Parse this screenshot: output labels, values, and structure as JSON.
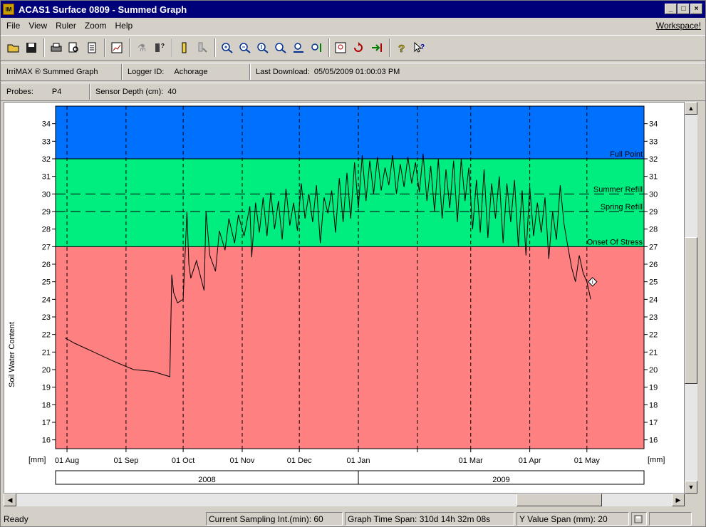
{
  "window": {
    "icon_label": "IM",
    "title": "ACAS1 Surface 0809 - Summed Graph",
    "controls": [
      "_",
      "□",
      "×"
    ]
  },
  "menu": {
    "items": [
      "File",
      "View",
      "Ruler",
      "Zoom",
      "Help"
    ],
    "workspace": "Workspace!"
  },
  "toolbar": {
    "icons": [
      "open-icon",
      "save-icon",
      "print-icon",
      "print-preview-icon",
      "page-icon",
      "graph-settings-icon",
      "flask-icon",
      "probe-settings-icon",
      "ruler-icon",
      "ruler-edit-icon",
      "zoom-in-x-icon",
      "zoom-out-x-icon",
      "zoom-in-y-icon",
      "zoom-out-y-icon",
      "zoom-baseline-icon",
      "zoom-last-icon",
      "zoom-fit-icon",
      "refresh-icon",
      "goto-end-icon",
      "help-icon",
      "context-help-icon"
    ]
  },
  "info": {
    "product": "IrriMAX ® Summed Graph",
    "logger_label": "Logger ID:",
    "logger_value": "Achorage",
    "download_label": "Last Download:",
    "download_value": "05/05/2009 01:00:03 PM",
    "probes_label": "Probes:",
    "probes_value": "P4",
    "depth_label": "Sensor Depth (cm):",
    "depth_value": "40"
  },
  "chart_data": {
    "type": "line",
    "ylabel": "Soil Water Content",
    "yunit_left": "[mm]",
    "yunit_right": "[mm]",
    "ylim": [
      15.5,
      35
    ],
    "yticks": [
      16,
      17,
      18,
      19,
      20,
      21,
      22,
      23,
      24,
      25,
      26,
      27,
      28,
      29,
      30,
      31,
      32,
      33,
      34
    ],
    "xlim": [
      "2008-07-26",
      "2009-05-31"
    ],
    "xtick_labels": [
      {
        "date": "2008-08-01",
        "label": "01 Aug"
      },
      {
        "date": "2008-09-01",
        "label": "01 Sep"
      },
      {
        "date": "2008-10-01",
        "label": "01 Oct"
      },
      {
        "date": "2008-11-01",
        "label": "01 Nov"
      },
      {
        "date": "2008-12-01",
        "label": "01 Dec"
      },
      {
        "date": "2009-01-01",
        "label": "01 Jan"
      },
      {
        "date": "2009-02-01",
        "label": ""
      },
      {
        "date": "2009-03-01",
        "label": "01 Mar"
      },
      {
        "date": "2009-04-01",
        "label": "01 Apr"
      },
      {
        "date": "2009-05-01",
        "label": "01 May"
      }
    ],
    "years": [
      {
        "label": "2008",
        "from": "2008-07-26",
        "to": "2009-01-01"
      },
      {
        "label": "2009",
        "from": "2009-01-01",
        "to": "2009-05-31"
      }
    ],
    "bands": [
      {
        "name": "saturated",
        "from": 32,
        "to": 35,
        "color": "#0070ff"
      },
      {
        "name": "optimal",
        "from": 27,
        "to": 32,
        "color": "#00ee80"
      },
      {
        "name": "stress",
        "from": 15.5,
        "to": 27,
        "color": "#ff8080"
      }
    ],
    "reference_lines": [
      {
        "label": "Full Point",
        "value": 32,
        "style": "solid"
      },
      {
        "label": "Summer Refill",
        "value": 30,
        "style": "dashed"
      },
      {
        "label": "Spring Refill",
        "value": 29,
        "style": "dashed"
      },
      {
        "label": "Onset Of Stress",
        "value": 27,
        "style": "solid"
      }
    ],
    "series": [
      {
        "color": "#000000",
        "x": [
          "2008-07-31",
          "2008-08-05",
          "2008-08-15",
          "2008-08-25",
          "2008-09-05",
          "2008-09-15",
          "2008-09-24",
          "2008-09-25",
          "2008-09-26",
          "2008-09-28",
          "2008-10-01",
          "2008-10-03",
          "2008-10-04",
          "2008-10-05",
          "2008-10-08",
          "2008-10-12",
          "2008-10-13",
          "2008-10-15",
          "2008-10-18",
          "2008-10-20",
          "2008-10-23",
          "2008-10-25",
          "2008-10-28",
          "2008-10-30",
          "2008-11-02",
          "2008-11-05",
          "2008-11-06",
          "2008-11-08",
          "2008-11-10",
          "2008-11-12",
          "2008-11-14",
          "2008-11-16",
          "2008-11-18",
          "2008-11-20",
          "2008-11-22",
          "2008-11-24",
          "2008-11-26",
          "2008-11-28",
          "2008-11-30",
          "2008-12-02",
          "2008-12-04",
          "2008-12-06",
          "2008-12-08",
          "2008-12-10",
          "2008-12-12",
          "2008-12-14",
          "2008-12-16",
          "2008-12-18",
          "2008-12-20",
          "2008-12-22",
          "2008-12-24",
          "2008-12-26",
          "2008-12-28",
          "2008-12-30",
          "2009-01-01",
          "2009-01-03",
          "2009-01-05",
          "2009-01-07",
          "2009-01-09",
          "2009-01-11",
          "2009-01-13",
          "2009-01-15",
          "2009-01-17",
          "2009-01-19",
          "2009-01-21",
          "2009-01-23",
          "2009-01-25",
          "2009-01-27",
          "2009-01-29",
          "2009-01-31",
          "2009-02-02",
          "2009-02-04",
          "2009-02-06",
          "2009-02-08",
          "2009-02-10",
          "2009-02-12",
          "2009-02-14",
          "2009-02-16",
          "2009-02-18",
          "2009-02-20",
          "2009-02-22",
          "2009-02-24",
          "2009-02-26",
          "2009-02-28",
          "2009-03-02",
          "2009-03-04",
          "2009-03-06",
          "2009-03-08",
          "2009-03-10",
          "2009-03-12",
          "2009-03-14",
          "2009-03-16",
          "2009-03-18",
          "2009-03-20",
          "2009-03-22",
          "2009-03-24",
          "2009-03-26",
          "2009-03-28",
          "2009-03-30",
          "2009-04-01",
          "2009-04-03",
          "2009-04-05",
          "2009-04-07",
          "2009-04-09",
          "2009-04-11",
          "2009-04-13",
          "2009-04-15",
          "2009-04-17",
          "2009-04-19",
          "2009-04-21",
          "2009-04-23",
          "2009-04-25",
          "2009-04-27",
          "2009-04-29",
          "2009-05-01",
          "2009-05-03"
        ],
        "y": [
          21.8,
          21.5,
          21.0,
          20.5,
          20.0,
          19.9,
          19.6,
          25.4,
          24.4,
          23.8,
          24.0,
          29.0,
          26.0,
          25.2,
          26.2,
          24.5,
          29.0,
          26.5,
          25.6,
          27.9,
          26.8,
          28.6,
          27.2,
          28.8,
          27.6,
          29.3,
          26.4,
          29.5,
          27.8,
          29.8,
          27.6,
          30.1,
          28.0,
          29.6,
          27.4,
          30.3,
          28.2,
          29.5,
          27.9,
          30.6,
          28.6,
          30.0,
          28.4,
          30.5,
          27.2,
          29.8,
          28.9,
          30.2,
          27.8,
          30.9,
          28.4,
          31.2,
          28.6,
          31.8,
          29.2,
          32.2,
          29.6,
          31.9,
          30.0,
          32.1,
          30.2,
          31.5,
          30.5,
          32.2,
          30.0,
          31.7,
          30.4,
          32.1,
          30.6,
          31.8,
          30.1,
          32.3,
          29.6,
          31.6,
          29.0,
          32.0,
          28.6,
          31.4,
          29.2,
          31.9,
          28.4,
          32.0,
          29.6,
          31.5,
          28.0,
          30.8,
          27.8,
          31.4,
          27.5,
          30.6,
          28.6,
          31.0,
          27.2,
          30.6,
          28.4,
          30.8,
          27.0,
          30.2,
          26.5,
          30.4,
          27.6,
          29.5,
          27.8,
          29.8,
          26.3,
          29.0,
          27.4,
          30.5,
          28.3,
          27.0,
          25.8,
          25.0,
          26.5,
          25.5,
          25.0,
          24.0
        ]
      }
    ],
    "marker": {
      "date": "2009-05-04",
      "value": 25.0,
      "label": "i"
    }
  },
  "status": {
    "ready": "Ready",
    "sampling": "Current Sampling Int.(min):  60",
    "timespan": "Graph Time Span:  310d 14h 32m 08s",
    "yspan": "Y Value Span (mm):  20"
  }
}
